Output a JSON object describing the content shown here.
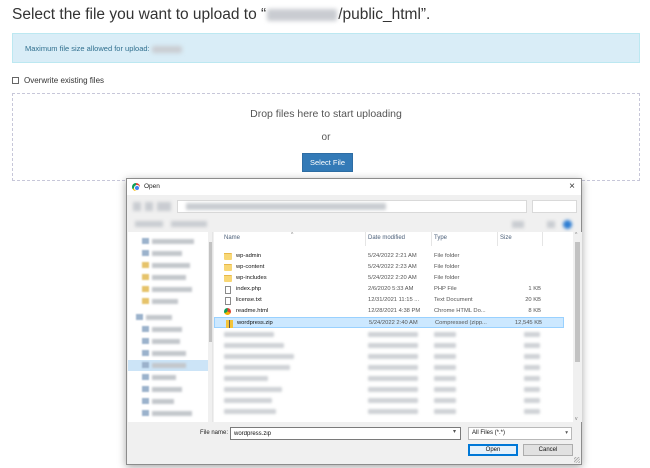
{
  "header": {
    "title_prefix": "Select the file you want to upload to “",
    "title_suffix": "/public_html”."
  },
  "info": {
    "text": "Maximum file size allowed for upload:"
  },
  "overwrite": {
    "label": "Overwrite existing files"
  },
  "dropzone": {
    "drop_text": "Drop files here to start uploading",
    "or_text": "or",
    "select_label": "Select File"
  },
  "dialog": {
    "title": "Open",
    "columns": {
      "name": "Name",
      "date": "Date modified",
      "type": "Type",
      "size": "Size"
    },
    "files": [
      {
        "name": "wp-admin",
        "date": "5/24/2022 2:21 AM",
        "type": "File folder",
        "size": "",
        "icon": "folder-icon"
      },
      {
        "name": "wp-content",
        "date": "5/24/2022 2:23 AM",
        "type": "File folder",
        "size": "",
        "icon": "folder-icon"
      },
      {
        "name": "wp-includes",
        "date": "5/24/2022 2:20 AM",
        "type": "File folder",
        "size": "",
        "icon": "folder-icon"
      },
      {
        "name": "index.php",
        "date": "2/6/2020 5:33 AM",
        "type": "PHP File",
        "size": "1 KB",
        "icon": "document-icon"
      },
      {
        "name": "license.txt",
        "date": "12/31/2021 11:15 ...",
        "type": "Text Document",
        "size": "20 KB",
        "icon": "document-icon"
      },
      {
        "name": "readme.html",
        "date": "12/28/2021 4:38 PM",
        "type": "Chrome HTML Do...",
        "size": "8 KB",
        "icon": "chrome-icon"
      },
      {
        "name": "wordpress.zip",
        "date": "5/24/2022 2:40 AM",
        "type": "Compressed (zipp...",
        "size": "12,545 KB",
        "icon": "zip-icon",
        "selected": true
      }
    ],
    "filename_label": "File name:",
    "filename_value": "wordpress.zip",
    "filter_value": "All Files (*.*)",
    "open_label": "Open",
    "cancel_label": "Cancel"
  }
}
